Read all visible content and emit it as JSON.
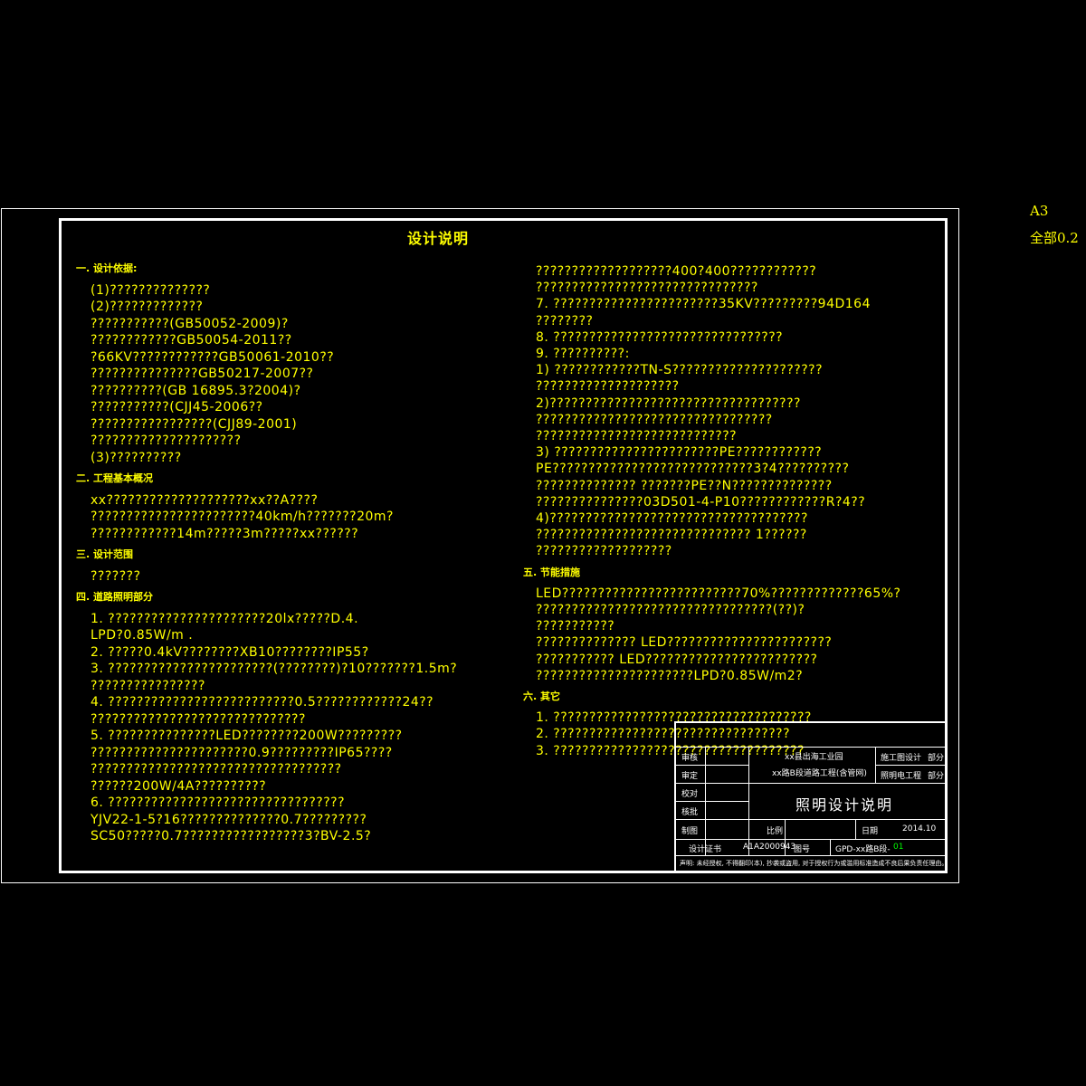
{
  "corner": {
    "sheet_size": "A3",
    "scale": "全部0.2"
  },
  "title": "设计说明",
  "left_col": [
    {
      "t": "一. 设计依据:",
      "h": true
    },
    {
      "t": "(1)??????????????"
    },
    {
      "t": "(2)?????????????"
    },
    {
      "t": "???????????(GB50052-2009)?"
    },
    {
      "t": "????????????GB50054-2011??"
    },
    {
      "t": "?66KV????????????GB50061-2010??"
    },
    {
      "t": "???????????????GB50217-2007??"
    },
    {
      "t": "??????????(GB 16895.3?2004)?"
    },
    {
      "t": "???????????(CJJ45-2006??"
    },
    {
      "t": "?????????????????(CJJ89-2001)"
    },
    {
      "t": "?????????????????????"
    },
    {
      "t": "(3)??????????"
    },
    {
      "t": "二. 工程基本概况",
      "h": true
    },
    {
      "t": "xx????????????????????xx??A????"
    },
    {
      "t": "???????????????????????40km/h???????20m?"
    },
    {
      "t": "????????????14m?????3m?????xx??????"
    },
    {
      "t": "三. 设计范围",
      "h": true
    },
    {
      "t": "???????"
    },
    {
      "t": "四. 道路照明部分",
      "h": true
    },
    {
      "t": "1. ??????????????????????20lx?????D.4."
    },
    {
      "t": "LPD?0.85W/m ."
    },
    {
      "t": "2. ?????0.4kV????????XB10????????IP55?"
    },
    {
      "t": "3. ???????????????????????(????????)?10???????1.5m?"
    },
    {
      "t": "????????????????"
    },
    {
      "t": "4. ??????????????????????????0.5????????????24??"
    },
    {
      "t": "??????????????????????????????"
    },
    {
      "t": "5. ???????????????LED????????200W?????????"
    },
    {
      "t": "??????????????????????0.9?????????IP65????"
    },
    {
      "t": "???????????????????????????????????"
    },
    {
      "t": "??????200W/4A??????????"
    },
    {
      "t": "6. ?????????????????????????????????"
    },
    {
      "t": "YJV22-1-5?16??????????????0.7?????????"
    },
    {
      "t": "SC50?????0.7?????????????????3?BV-2.5?"
    }
  ],
  "right_col": [
    {
      "t": "???????????????????400?400????????????"
    },
    {
      "t": "???????????????????????????????"
    },
    {
      "t": "7. ???????????????????????35KV?????????94D164"
    },
    {
      "t": "????????"
    },
    {
      "t": "8. ????????????????????????????????"
    },
    {
      "t": "9. ??????????:"
    },
    {
      "t": "1) ????????????TN-S?????????????????????"
    },
    {
      "t": "????????????????????"
    },
    {
      "t": "2)???????????????????????????????????"
    },
    {
      "t": "?????????????????????????????????"
    },
    {
      "t": "????????????????????????????"
    },
    {
      "t": "3) ???????????????????????PE????????????"
    },
    {
      "t": "PE????????????????????????????3?4??????????"
    },
    {
      "t": "?????????????? ???????PE??N??????????????"
    },
    {
      "t": "???????????????03D501-4-P10????????????R?4??"
    },
    {
      "t": "4)????????????????????????????????????"
    },
    {
      "t": "?????????????????????????????? 1??????"
    },
    {
      "t": "???????????????????"
    },
    {
      "t": "五. 节能措施",
      "h": true
    },
    {
      "t": "LED?????????????????????????70%?????????????65%?"
    },
    {
      "t": "?????????????????????????????????(??)?"
    },
    {
      "t": "???????????"
    },
    {
      "t": "?????????????? LED???????????????????????"
    },
    {
      "t": "??????????? LED????????????????????????"
    },
    {
      "t": "??????????????????????LPD?0.85W/m2?"
    },
    {
      "t": "六. 其它",
      "h": true
    },
    {
      "t": "1. ????????????????????????????????????"
    },
    {
      "t": "2. ?????????????????????????????????"
    },
    {
      "t": "3. ???????????????????????????????????"
    }
  ],
  "title_block": {
    "labels": [
      "审核",
      "审定",
      "校对",
      "核批",
      "制图"
    ],
    "project_line1": "xx县出海工业园",
    "project_line2": "xx路B段道路工程(含管网)",
    "stage": "施工图设计",
    "stage_suffix": "部分",
    "discipline": "照明电工程",
    "discipline_suffix": "部分",
    "drawing_title": "照明设计说明",
    "scale_label": "比例",
    "date_label": "日期",
    "date": "2014.10",
    "cert_label": "设计证书",
    "cert_no": "A1A2000943",
    "drawing_no_label": "图号",
    "drawing_no": "GPD-xx路B段-",
    "drawing_no_suffix": "01",
    "notice": "声明: 未经授权, 不得翻印(本), 抄袭或盗用, 对于授权行为或滥用标准造成不良后果负责任理由。"
  }
}
